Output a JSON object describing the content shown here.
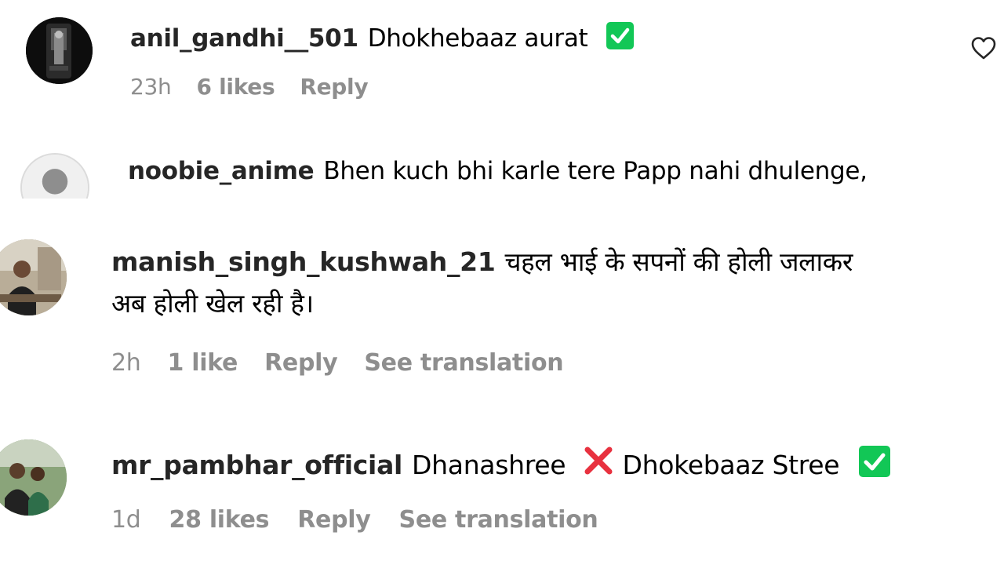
{
  "comments": [
    {
      "username": "anil_gandhi__501",
      "text": "Dhokhebaaz aurat",
      "emoji": "check-mark-button-icon",
      "time": "23h",
      "likes": "6 likes",
      "reply": "Reply"
    },
    {
      "username": "noobie_anime",
      "text": "Bhen kuch bhi karle tere Papp nahi dhulenge,"
    },
    {
      "username": "manish_singh_kushwah_21",
      "text_line1": "चहल भाई के सपनों की होली जलाकर",
      "text_line2": "अब होली खेल रही है।",
      "time": "2h",
      "likes": "1 like",
      "reply": "Reply",
      "see_translation": "See translation"
    },
    {
      "username": "mr_pambhar_official",
      "text_part1": "Dhanashree",
      "cross_emoji": "cross-mark-icon",
      "text_part2": "Dhokebaaz Stree",
      "emoji": "check-mark-button-icon",
      "time": "1d",
      "likes": "28 likes",
      "reply": "Reply",
      "see_translation": "See translation"
    }
  ],
  "icons": {
    "heart": "heart-outline-icon"
  },
  "colors": {
    "meta_text": "#8e8e8e",
    "check_green": "#12c756",
    "cross_red": "#e8313f"
  }
}
